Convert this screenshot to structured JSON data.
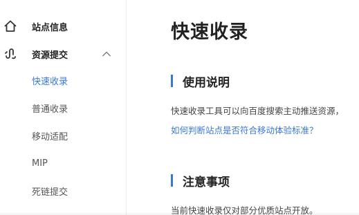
{
  "sidebar": {
    "items": [
      {
        "label": "站点信息",
        "icon": "home-icon"
      },
      {
        "label": "资源提交",
        "icon": "link-icon",
        "expanded": true
      }
    ],
    "sub_items": [
      {
        "label": "快速收录",
        "active": true
      },
      {
        "label": "普通收录"
      },
      {
        "label": "移动适配"
      },
      {
        "label": "MIP"
      },
      {
        "label": "死链提交"
      }
    ]
  },
  "main": {
    "title": "快速收录",
    "usage": {
      "heading": "使用说明",
      "text": "快速收录工具可以向百度搜索主动推送资源，",
      "link": "如何判断站点是否符合移动体验标准？"
    },
    "notice": {
      "heading": "注意事项",
      "text": "当前快速收录仅对部分优质站点开放。"
    }
  },
  "colors": {
    "accent": "#3878d6",
    "text": "#222222"
  }
}
